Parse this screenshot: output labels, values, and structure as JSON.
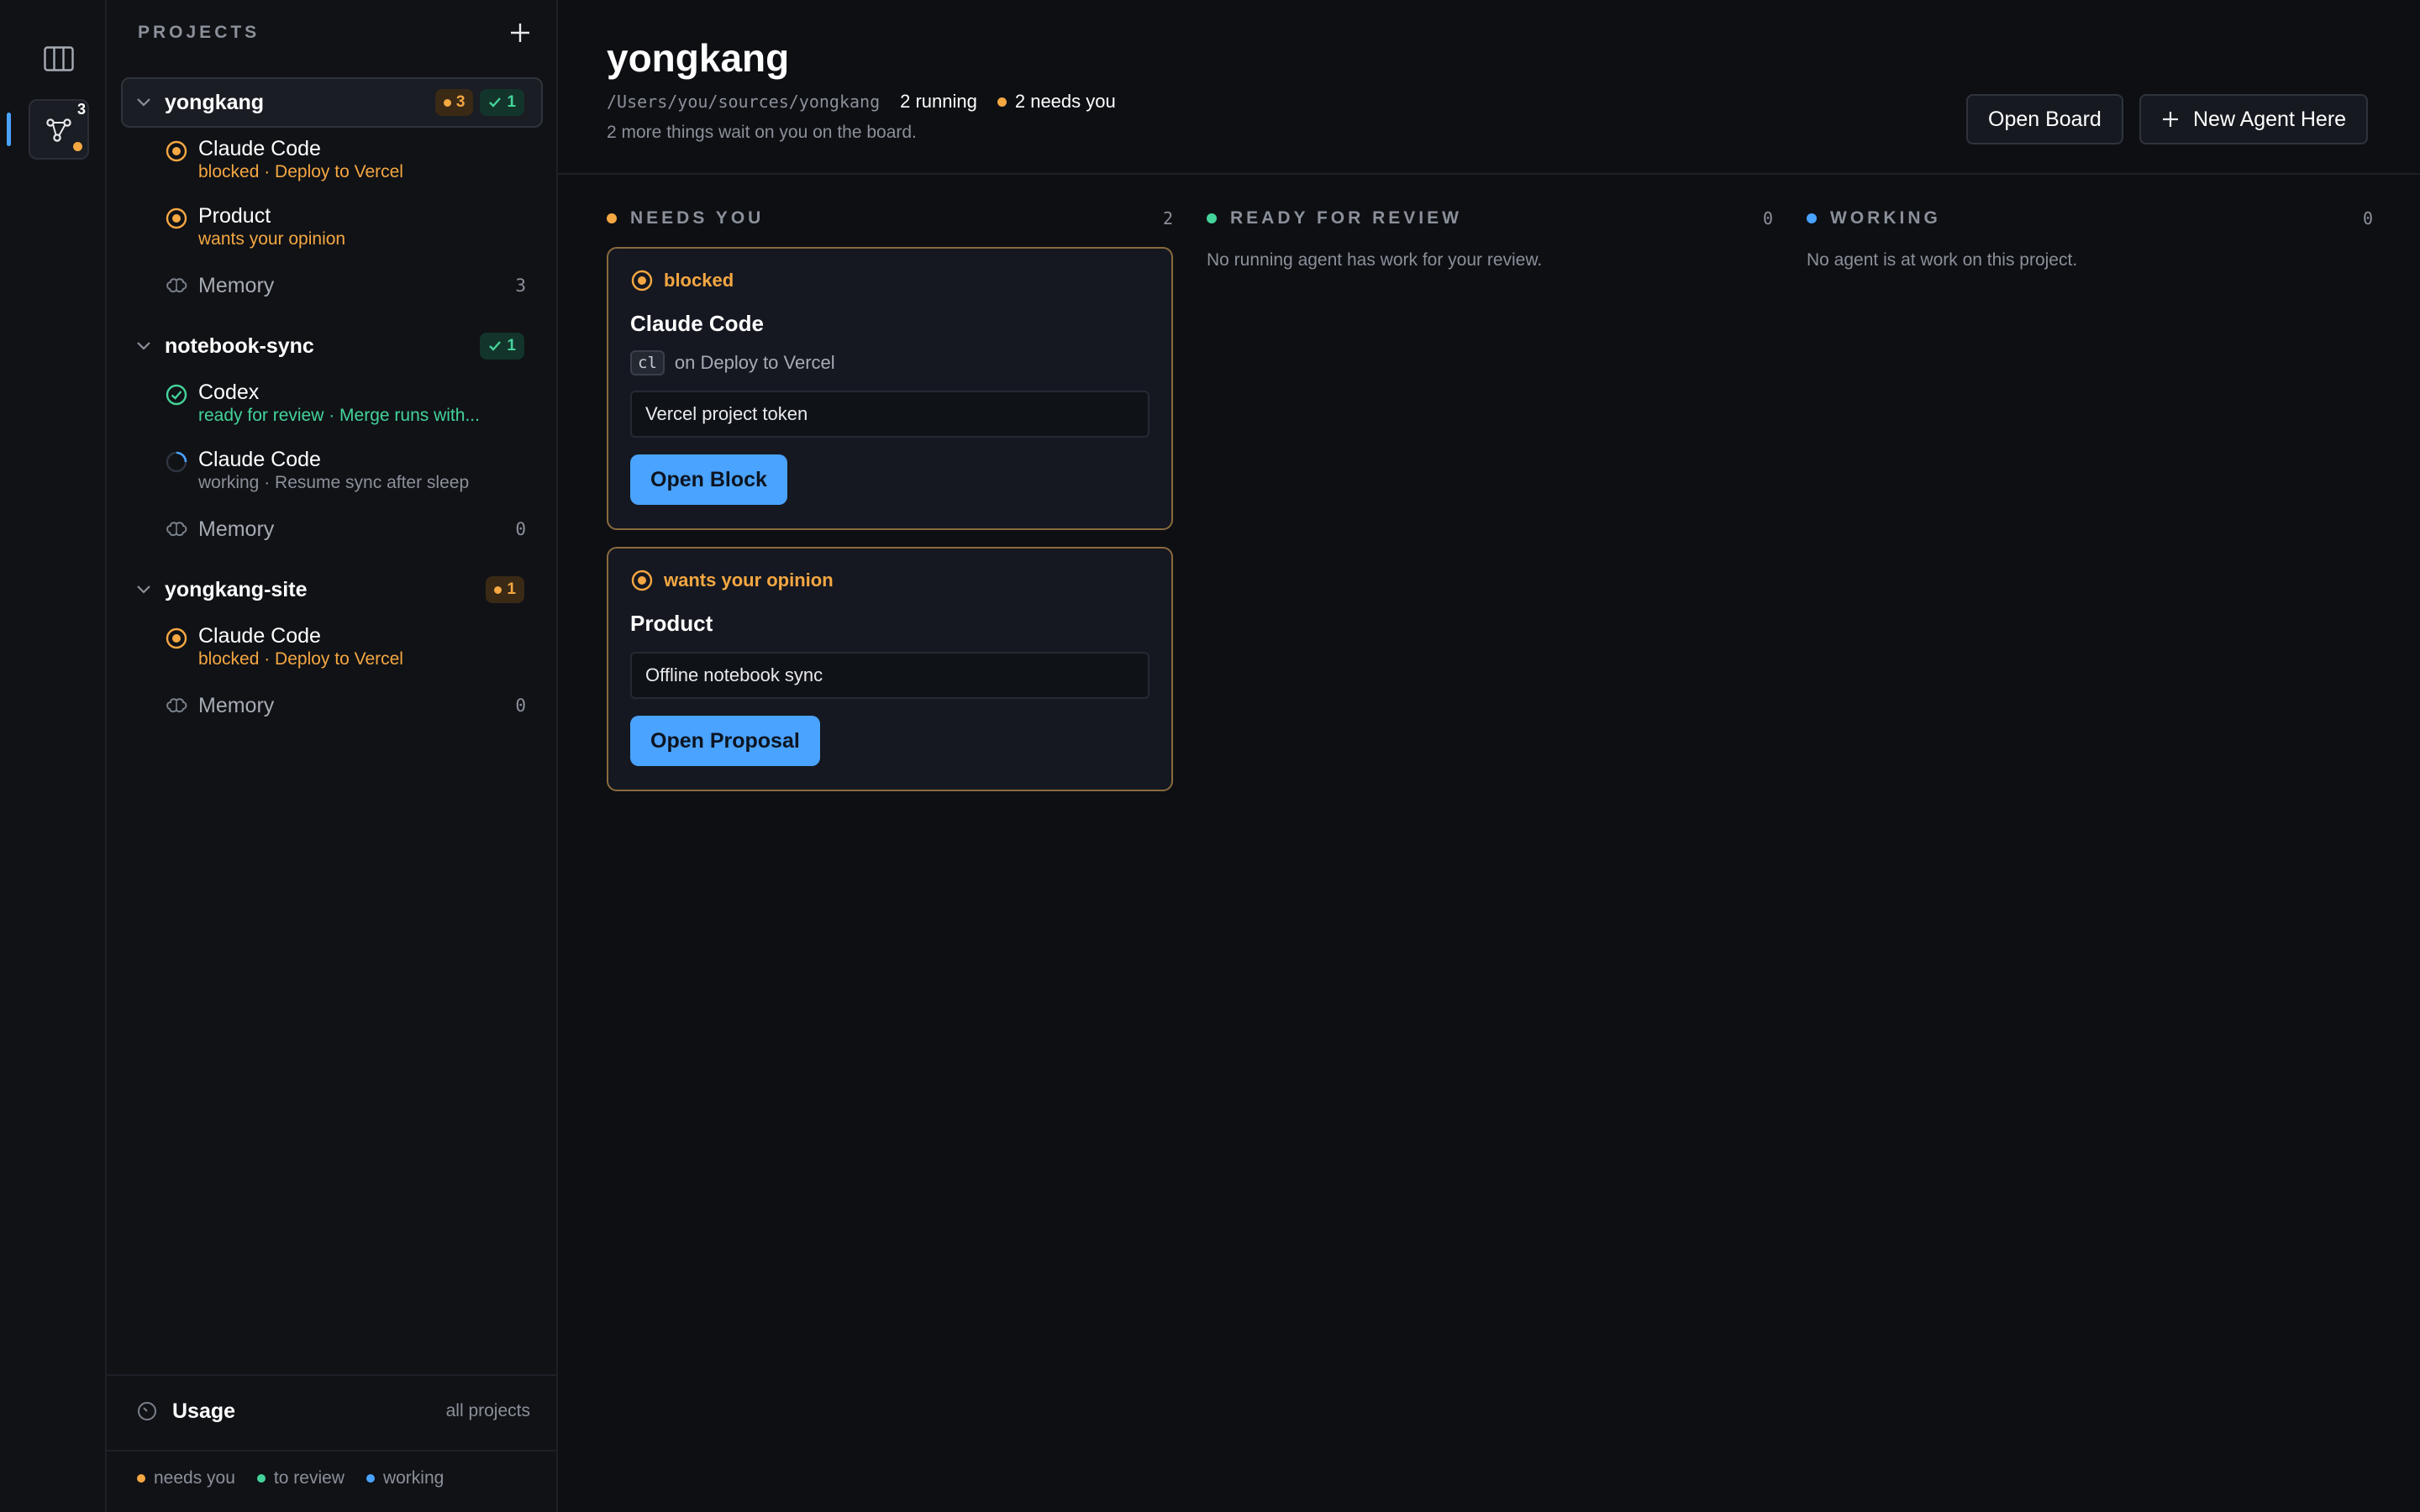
{
  "rail": {
    "project_count": "3"
  },
  "sidebar": {
    "projects_label": "PROJECTS",
    "projects": [
      {
        "name": "yongkang",
        "badge_needs": "3",
        "badge_done": "1",
        "agents": [
          {
            "name": "Claude Code",
            "sub": "blocked · Deploy to Vercel"
          },
          {
            "name": "Product",
            "sub": "wants your opinion"
          }
        ],
        "memory_label": "Memory",
        "memory_count": "3"
      },
      {
        "name": "notebook-sync",
        "badge_done": "1",
        "agents": [
          {
            "name": "Codex",
            "sub": "ready for review · Merge runs with..."
          },
          {
            "name": "Claude Code",
            "sub": "working · Resume sync after sleep"
          }
        ],
        "memory_label": "Memory",
        "memory_count": "0"
      },
      {
        "name": "yongkang-site",
        "badge_needs": "1",
        "agents": [
          {
            "name": "Claude Code",
            "sub": "blocked · Deploy to Vercel"
          }
        ],
        "memory_label": "Memory",
        "memory_count": "0"
      }
    ],
    "usage_label": "Usage",
    "usage_scope": "all projects",
    "legend": [
      "needs you",
      "to review",
      "working"
    ]
  },
  "main": {
    "title": "yongkang",
    "path": "/Users/you/sources/yongkang",
    "running": "2 running",
    "needs": "2 needs you",
    "wait_text": "2 more things wait on you on the board.",
    "open_board_label": "Open Board",
    "new_agent_label": "New Agent Here",
    "columns": [
      {
        "title": "NEEDS YOU",
        "count": "2"
      },
      {
        "title": "READY FOR REVIEW",
        "count": "0",
        "empty": "No running agent has work for your review."
      },
      {
        "title": "WORKING",
        "count": "0",
        "empty": "No agent is at work on this project."
      }
    ],
    "cards": [
      {
        "status": "blocked",
        "title": "Claude Code",
        "tag": "cl",
        "meta": "on Deploy to Vercel",
        "field": "Vercel project token",
        "button": "Open Block"
      },
      {
        "status": "wants your opinion",
        "title": "Product",
        "field": "Offline notebook sync",
        "button": "Open Proposal"
      }
    ]
  },
  "colors": {
    "needs": "#f5a742",
    "review": "#44d39a",
    "working": "#4aa3ff",
    "accent": "#4aa3ff",
    "background": "#0d0f13"
  }
}
